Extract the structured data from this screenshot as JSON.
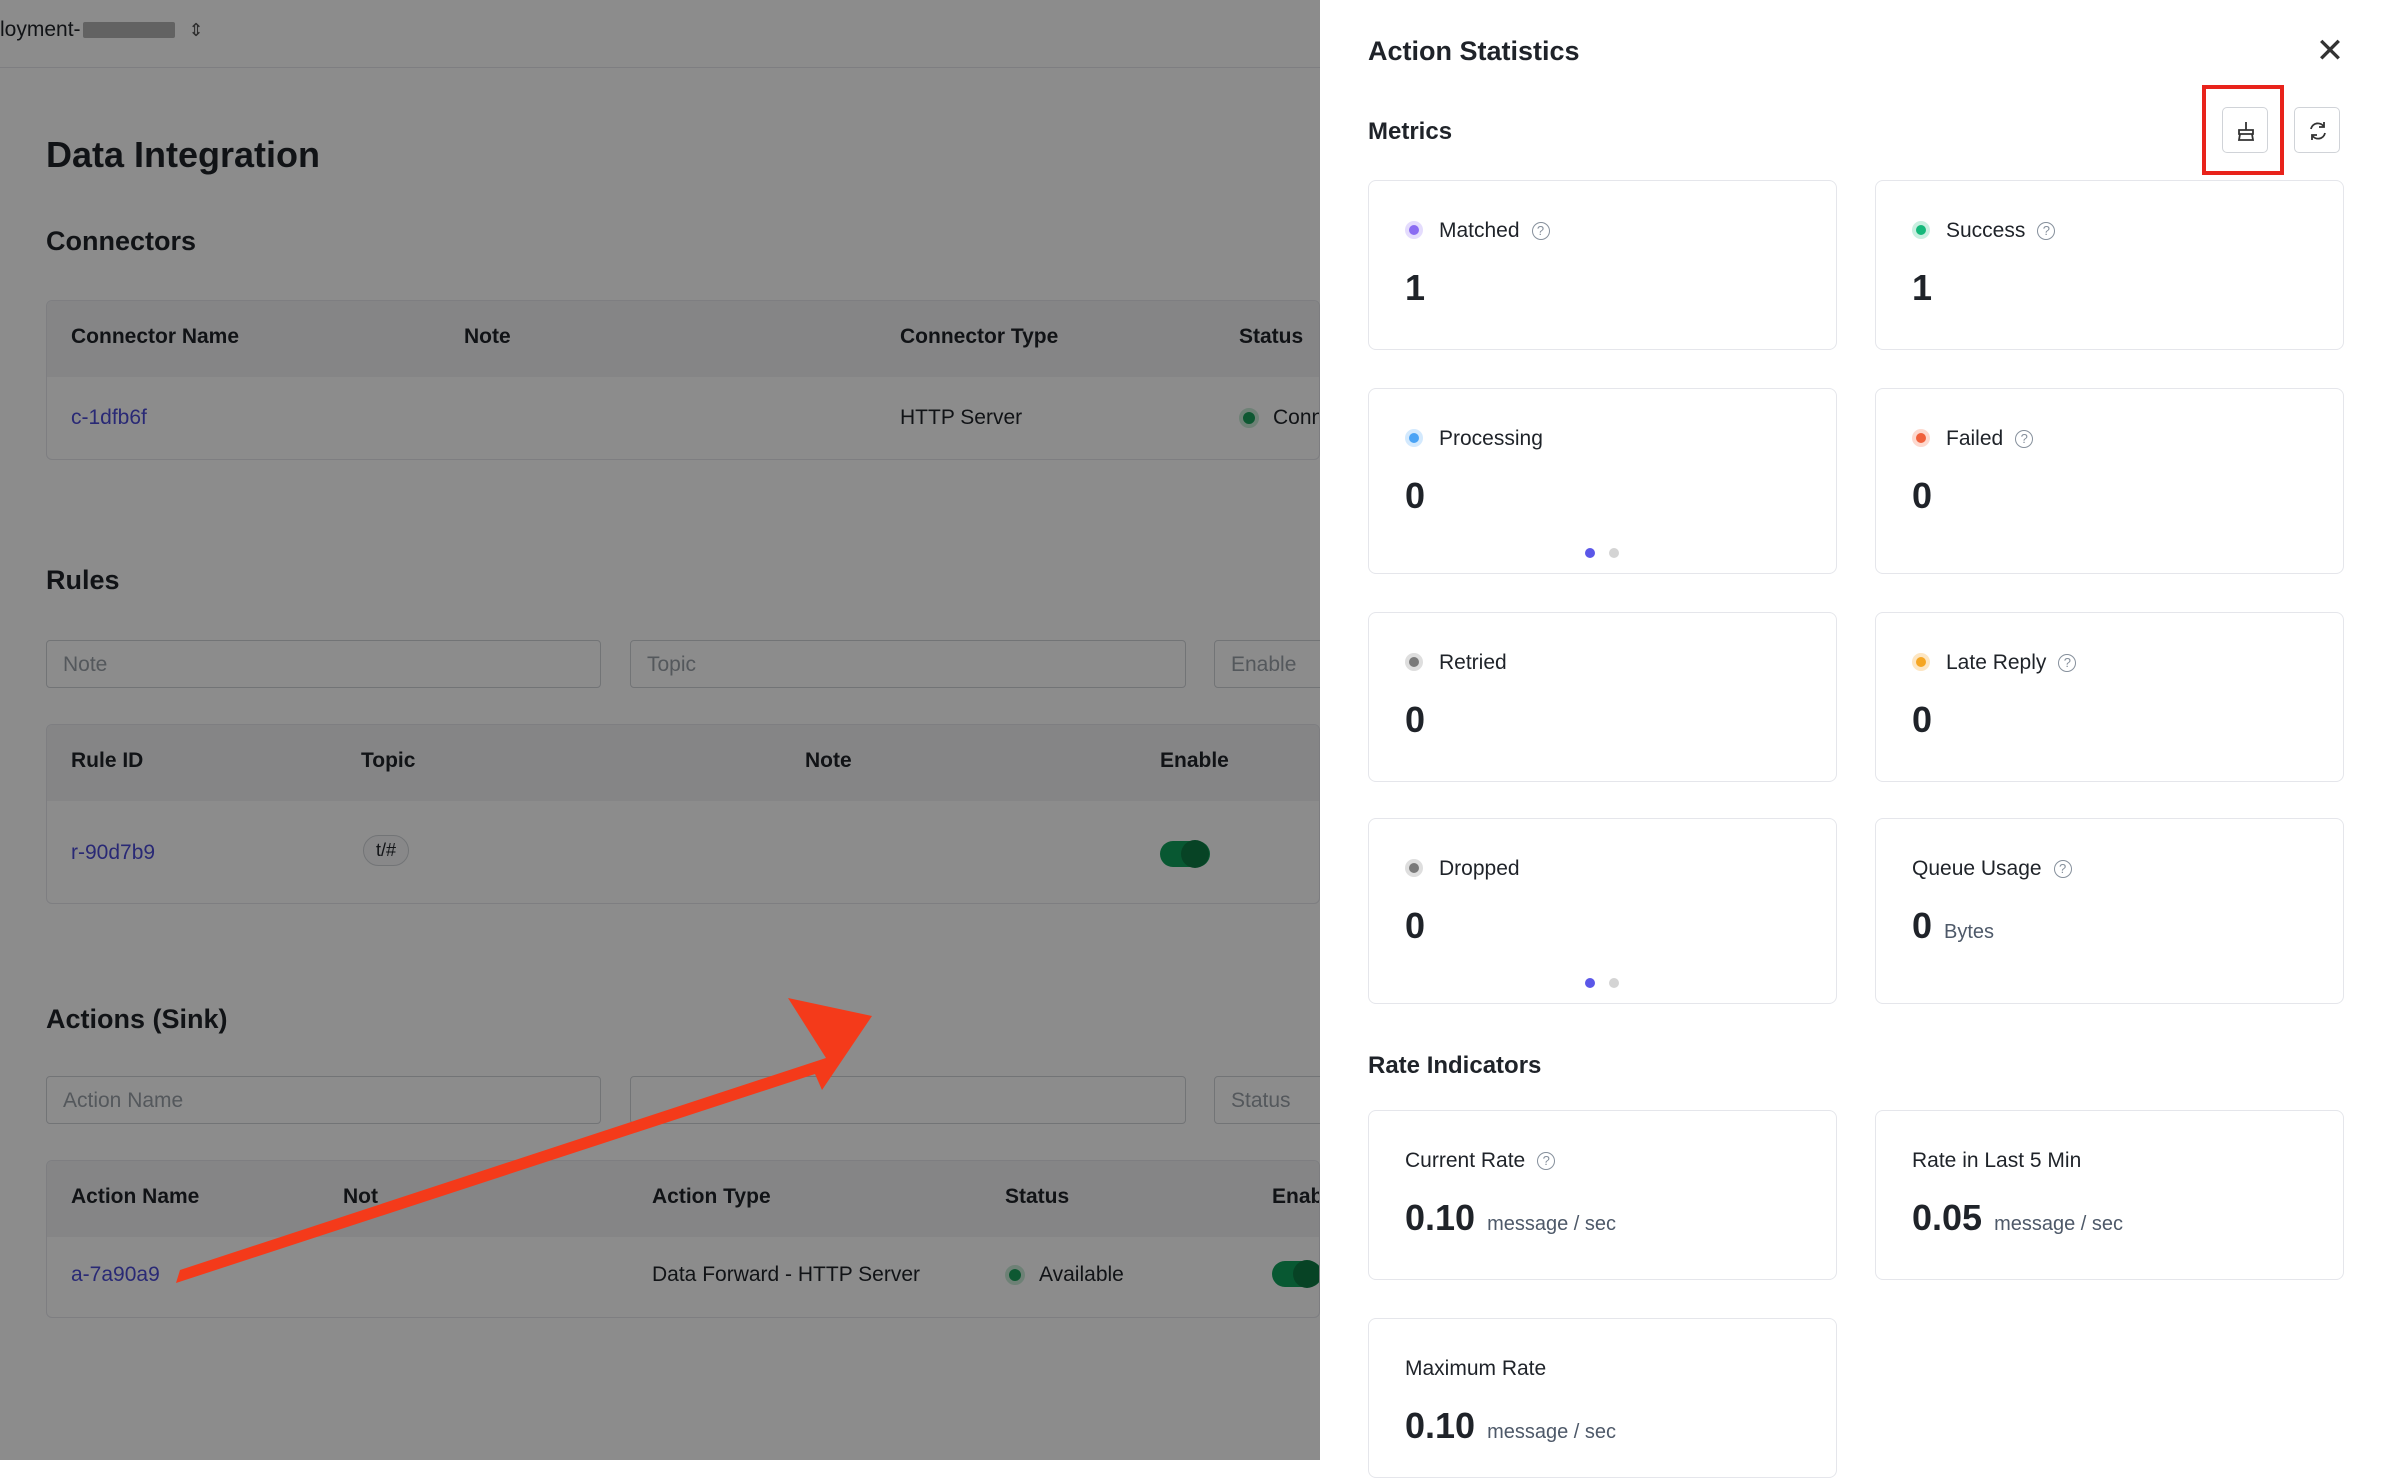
{
  "background": {
    "deployment_label": "loyment-",
    "page_title": "Data Integration",
    "connectors": {
      "title": "Connectors",
      "columns": [
        "Connector Name",
        "Note",
        "Connector Type",
        "Status"
      ],
      "row": {
        "name": "c-1dfb6f",
        "type": "HTTP Server",
        "status": "Conn"
      }
    },
    "rules": {
      "title": "Rules",
      "filters": {
        "note": "Note",
        "topic": "Topic",
        "enable": "Enable"
      },
      "columns": [
        "Rule ID",
        "Topic",
        "Note",
        "Enable"
      ],
      "row": {
        "id": "r-90d7b9",
        "topic": "t/#"
      }
    },
    "actions": {
      "title": "Actions (Sink)",
      "filters": {
        "name": "Action Name",
        "status": "Status"
      },
      "columns": [
        "Action Name",
        "Not",
        "Action Type",
        "Status",
        "Enab"
      ],
      "row": {
        "name": "a-7a90a9",
        "type": "Data Forward - HTTP Server",
        "status": "Available"
      }
    }
  },
  "drawer": {
    "title": "Action Statistics",
    "close_icon": "close-icon",
    "metrics_title": "Metrics",
    "metrics": [
      {
        "label": "Matched",
        "value": "1",
        "color": "#8a6cf2",
        "ring": "#e4dcfd"
      },
      {
        "label": "Success",
        "value": "1",
        "color": "#14b87a",
        "ring": "#c8efe0"
      },
      {
        "label": "Processing",
        "value": "0",
        "color": "#4aa3f5",
        "ring": "#d3e9fd"
      },
      {
        "label": "Failed",
        "value": "0",
        "color": "#f0613c",
        "ring": "#fdd9cf"
      },
      {
        "label": "Retried",
        "value": "0",
        "color": "#7a7a7a",
        "ring": "#dedede"
      },
      {
        "label": "Late Reply",
        "value": "0",
        "color": "#f5a623",
        "ring": "#fde6c2"
      },
      {
        "label": "Dropped",
        "value": "0",
        "color": "#7a7a7a",
        "ring": "#dedede"
      },
      {
        "label": "Queue Usage",
        "value": "0",
        "unit": "Bytes"
      }
    ],
    "rate_title": "Rate Indicators",
    "rates": [
      {
        "label": "Current Rate",
        "value": "0.10",
        "unit": "message / sec"
      },
      {
        "label": "Rate in Last 5 Min",
        "value": "0.05",
        "unit": "message / sec"
      },
      {
        "label": "Maximum Rate",
        "value": "0.10",
        "unit": "message / sec"
      }
    ],
    "help_icon": "?"
  }
}
